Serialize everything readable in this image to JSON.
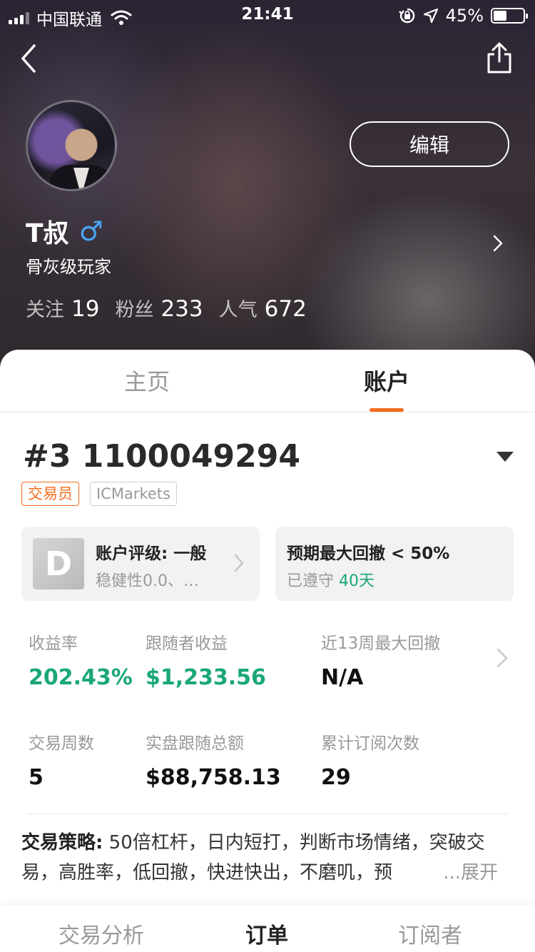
{
  "status_bar": {
    "carrier": "中国联通",
    "time": "21:41",
    "battery": "45%",
    "battery_level": 0.45
  },
  "header": {
    "edit_label": "编辑"
  },
  "profile": {
    "name": "T叔",
    "gender_symbol": "♂",
    "title": "骨灰级玩家",
    "stats": [
      {
        "label": "关注",
        "value": "19"
      },
      {
        "label": "粉丝",
        "value": "233"
      },
      {
        "label": "人气",
        "value": "672"
      }
    ]
  },
  "tabs": {
    "home": "主页",
    "account": "账户",
    "active": "account"
  },
  "account": {
    "number": "#3 1100049294",
    "tags": [
      "交易员",
      "ICMarkets"
    ],
    "rating_card": {
      "grade": "D",
      "title": "账户评级: 一般",
      "subtitle": "稳健性0.0、…"
    },
    "drawdown_card": {
      "title": "预期最大回撤 < 50%",
      "subtitle_prefix": "已遵守",
      "subtitle_value": "40天"
    },
    "metrics": [
      {
        "label": "收益率",
        "value": "202.43%"
      },
      {
        "label": "跟随者收益",
        "value": "$1,233.56"
      },
      {
        "label": "近13周最大回撤",
        "value": "N/A"
      },
      {
        "label": "交易周数",
        "value": "5"
      },
      {
        "label": "实盘跟随总额",
        "value": "$88,758.13"
      },
      {
        "label": "累计订阅次数",
        "value": "29"
      }
    ],
    "strategy": {
      "label": "交易策略:",
      "text": " 50倍杠杆，日内短打，判断市场情绪，突破交易，高胜率，低回撤，快进快出，不磨叽，预",
      "more": "...展开"
    }
  },
  "bottom_tabs": {
    "analysis": "交易分析",
    "orders": "订单",
    "subscribers": "订阅者"
  },
  "colors": {
    "accent": "#f26b1d",
    "positive": "#1aa776",
    "gender": "#4aa3f0"
  }
}
